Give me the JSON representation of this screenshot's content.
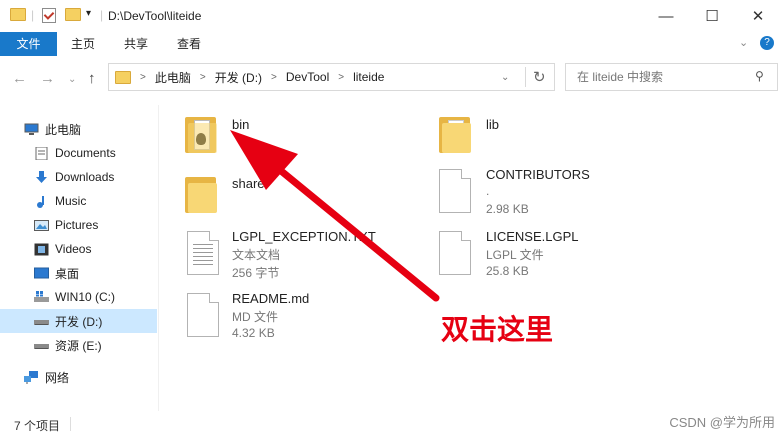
{
  "window": {
    "title": "D:\\DevTool\\liteide",
    "controls": [
      "—",
      "☐",
      "✕"
    ]
  },
  "ribbon": {
    "tabs": [
      "文件",
      "主页",
      "共享",
      "查看"
    ]
  },
  "address": {
    "crumbs": [
      "此电脑",
      "开发 (D:)",
      "DevTool",
      "liteide"
    ],
    "separator": ">",
    "search_placeholder": "在 liteide 中搜索"
  },
  "sidebar": {
    "items": [
      {
        "label": "此电脑",
        "icon": "computer-icon"
      },
      {
        "label": "Documents",
        "icon": "documents-icon"
      },
      {
        "label": "Downloads",
        "icon": "downloads-icon"
      },
      {
        "label": "Music",
        "icon": "music-icon"
      },
      {
        "label": "Pictures",
        "icon": "pictures-icon"
      },
      {
        "label": "Videos",
        "icon": "videos-icon"
      },
      {
        "label": "桌面",
        "icon": "desktop-icon"
      },
      {
        "label": "WIN10 (C:)",
        "icon": "drive-icon"
      },
      {
        "label": "开发 (D:)",
        "icon": "drive-icon",
        "selected": true
      },
      {
        "label": "资源 (E:)",
        "icon": "drive-icon"
      },
      {
        "label": "网络",
        "icon": "network-icon"
      }
    ]
  },
  "files": [
    {
      "name": "bin",
      "type": "folder"
    },
    {
      "name": "lib",
      "type": "folder"
    },
    {
      "name": "share",
      "type": "folder"
    },
    {
      "name": "CONTRIBUTORS",
      "type": "file",
      "meta": [
        ".",
        "2.98 KB"
      ]
    },
    {
      "name": "LGPL_EXCEPTION.TXT",
      "type": "file",
      "meta": [
        "文本文档",
        "256 字节"
      ]
    },
    {
      "name": "LICENSE.LGPL",
      "type": "file",
      "meta": [
        "LGPL 文件",
        "25.8 KB"
      ]
    },
    {
      "name": "README.md",
      "type": "file",
      "meta": [
        "MD 文件",
        "4.32 KB"
      ]
    }
  ],
  "status": {
    "text": "7 个项目"
  },
  "annotation": {
    "text": "双击这里",
    "color": "#e60012"
  },
  "watermark": "CSDN @学为所用"
}
